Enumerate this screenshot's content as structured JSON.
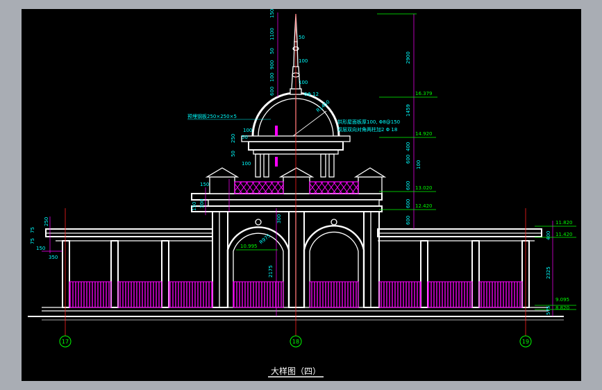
{
  "drawing": {
    "title": "大样图（四）",
    "colors": {
      "background": "#000000",
      "frame_gray": "#a9adb4",
      "structure": "#ffffff",
      "railing": "#ff00ff",
      "dimension_text": "#00ffff",
      "level_mark": "#00ff00",
      "dimension_line": "#ff00ff",
      "axis_line": "#ff2020"
    },
    "axes": [
      "17",
      "18",
      "19"
    ],
    "top_dimensions": [
      "150",
      "1100",
      "50",
      "900",
      "100",
      "600"
    ],
    "inline_dimensions": [
      "50",
      "100",
      "100"
    ],
    "right_dimensions": [
      "2900",
      "1459",
      "400",
      "600",
      "600",
      "600",
      "600",
      "100"
    ],
    "levels": [
      "16.379",
      "14.920",
      "13.020",
      "12.420",
      "11.820",
      "11.420",
      "9.095",
      "8.820",
      "10.995"
    ],
    "left_dimensions": [
      "150",
      "150",
      "300",
      "250",
      "75",
      "75",
      "150",
      "350",
      "250",
      "50",
      "100",
      "50"
    ],
    "mid_dimensions": [
      "300",
      "2175",
      "100",
      "2325",
      "400",
      "575"
    ],
    "annotations": {
      "steel_plate": "预埋钢板250×250×5",
      "top_rebar": "6Φ 12",
      "radius": "R1450",
      "roof_slab": "拱形屋面板厚100, Φ8@150",
      "double_rebar": "双层双向对角两柱加2 Φ 18",
      "arch_dim": "R975"
    }
  }
}
